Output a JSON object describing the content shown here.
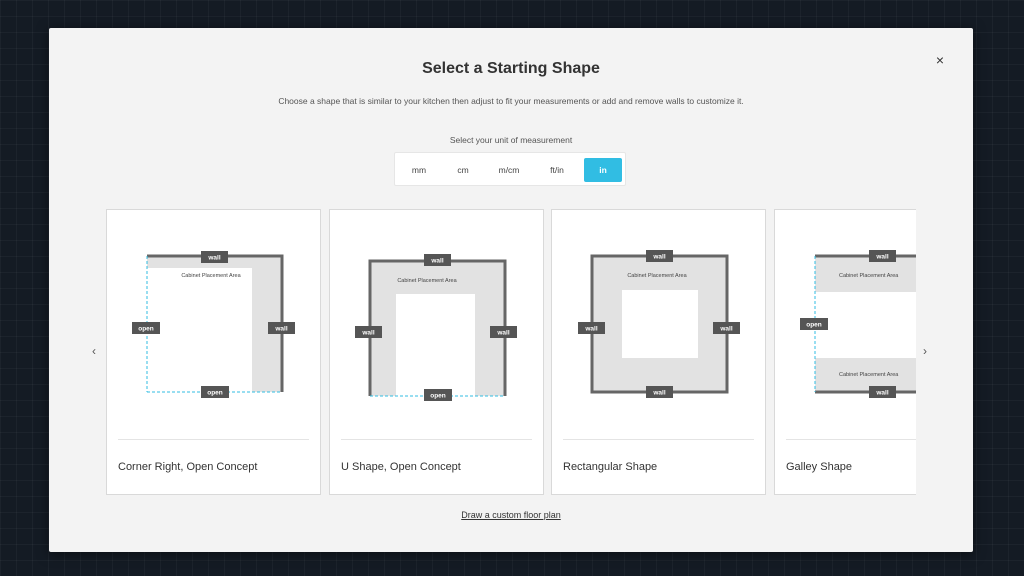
{
  "modal": {
    "title": "Select a Starting Shape",
    "subtitle": "Choose a shape that is similar to your kitchen then adjust to fit your measurements or add and remove walls to customize it.",
    "close_label": "×",
    "unit_label": "Select your unit of measurement",
    "units": [
      {
        "label": "mm",
        "active": false
      },
      {
        "label": "cm",
        "active": false
      },
      {
        "label": "m/cm",
        "active": false
      },
      {
        "label": "ft/in",
        "active": false
      },
      {
        "label": "in",
        "active": true
      }
    ],
    "prev_label": "‹",
    "next_label": "›",
    "custom_link": "Draw a custom floor plan"
  },
  "tags": {
    "wall": "wall",
    "open": "open",
    "area": "Cabinet Placement Area"
  },
  "shapes": [
    {
      "name": "Corner Right, Open Concept",
      "icon": "corner-right-shape"
    },
    {
      "name": "U Shape, Open Concept",
      "icon": "u-shape"
    },
    {
      "name": "Rectangular Shape",
      "icon": "rectangular-shape"
    },
    {
      "name": "Galley Shape",
      "icon": "galley-shape"
    }
  ],
  "colors": {
    "accent": "#31bde3",
    "wall": "#666666",
    "tag": "#555555",
    "area": "#e2e2e2",
    "open_line": "#31bde3"
  }
}
